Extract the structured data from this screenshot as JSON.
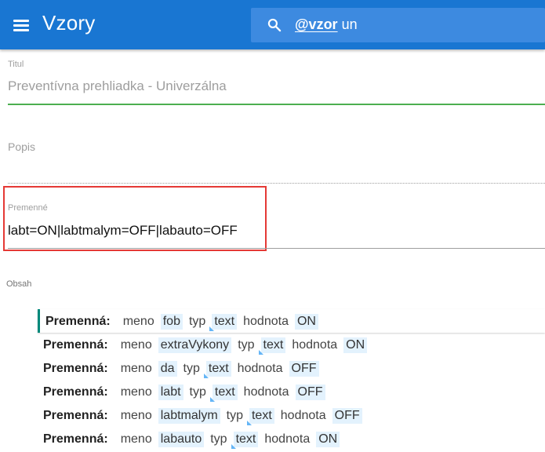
{
  "app": {
    "title": "Vzory",
    "search": {
      "tag": "@vzor",
      "query": "un"
    }
  },
  "form": {
    "titul": {
      "label": "Titul",
      "value": "Preventívna prehliadka - Univerzálna"
    },
    "popis": {
      "label": "Popis",
      "value": ""
    },
    "premenne": {
      "label": "Premenné",
      "value": "labt=ON|labtmalym=OFF|labauto=OFF"
    },
    "obsah": {
      "label": "Obsah"
    }
  },
  "variables": [
    {
      "keyword": "Premenná:",
      "meno_label": "meno",
      "meno": "fob",
      "typ_label": "typ",
      "typ": "text",
      "hodnota_label": "hodnota",
      "hodnota": "ON"
    },
    {
      "keyword": "Premenná:",
      "meno_label": "meno",
      "meno": "extraVykony",
      "typ_label": "typ",
      "typ": "text",
      "hodnota_label": "hodnota",
      "hodnota": "ON"
    },
    {
      "keyword": "Premenná:",
      "meno_label": "meno",
      "meno": "da",
      "typ_label": "typ",
      "typ": "text",
      "hodnota_label": "hodnota",
      "hodnota": "OFF"
    },
    {
      "keyword": "Premenná:",
      "meno_label": "meno",
      "meno": "labt",
      "typ_label": "typ",
      "typ": "text",
      "hodnota_label": "hodnota",
      "hodnota": "OFF"
    },
    {
      "keyword": "Premenná:",
      "meno_label": "meno",
      "meno": "labtmalym",
      "typ_label": "typ",
      "typ": "text",
      "hodnota_label": "hodnota",
      "hodnota": "OFF"
    },
    {
      "keyword": "Premenná:",
      "meno_label": "meno",
      "meno": "labauto",
      "typ_label": "typ",
      "typ": "text",
      "hodnota_label": "hodnota",
      "hodnota": "ON"
    }
  ],
  "colors": {
    "appbar": "#1976d2",
    "search_bg": "#3d8ae0",
    "focus_underline": "#4caf50",
    "highlight_box": "#e53935",
    "active_row_marker": "#00897b",
    "chip_bg": "#e3f2fd"
  },
  "icons": [
    "menu-icon",
    "search-icon"
  ]
}
